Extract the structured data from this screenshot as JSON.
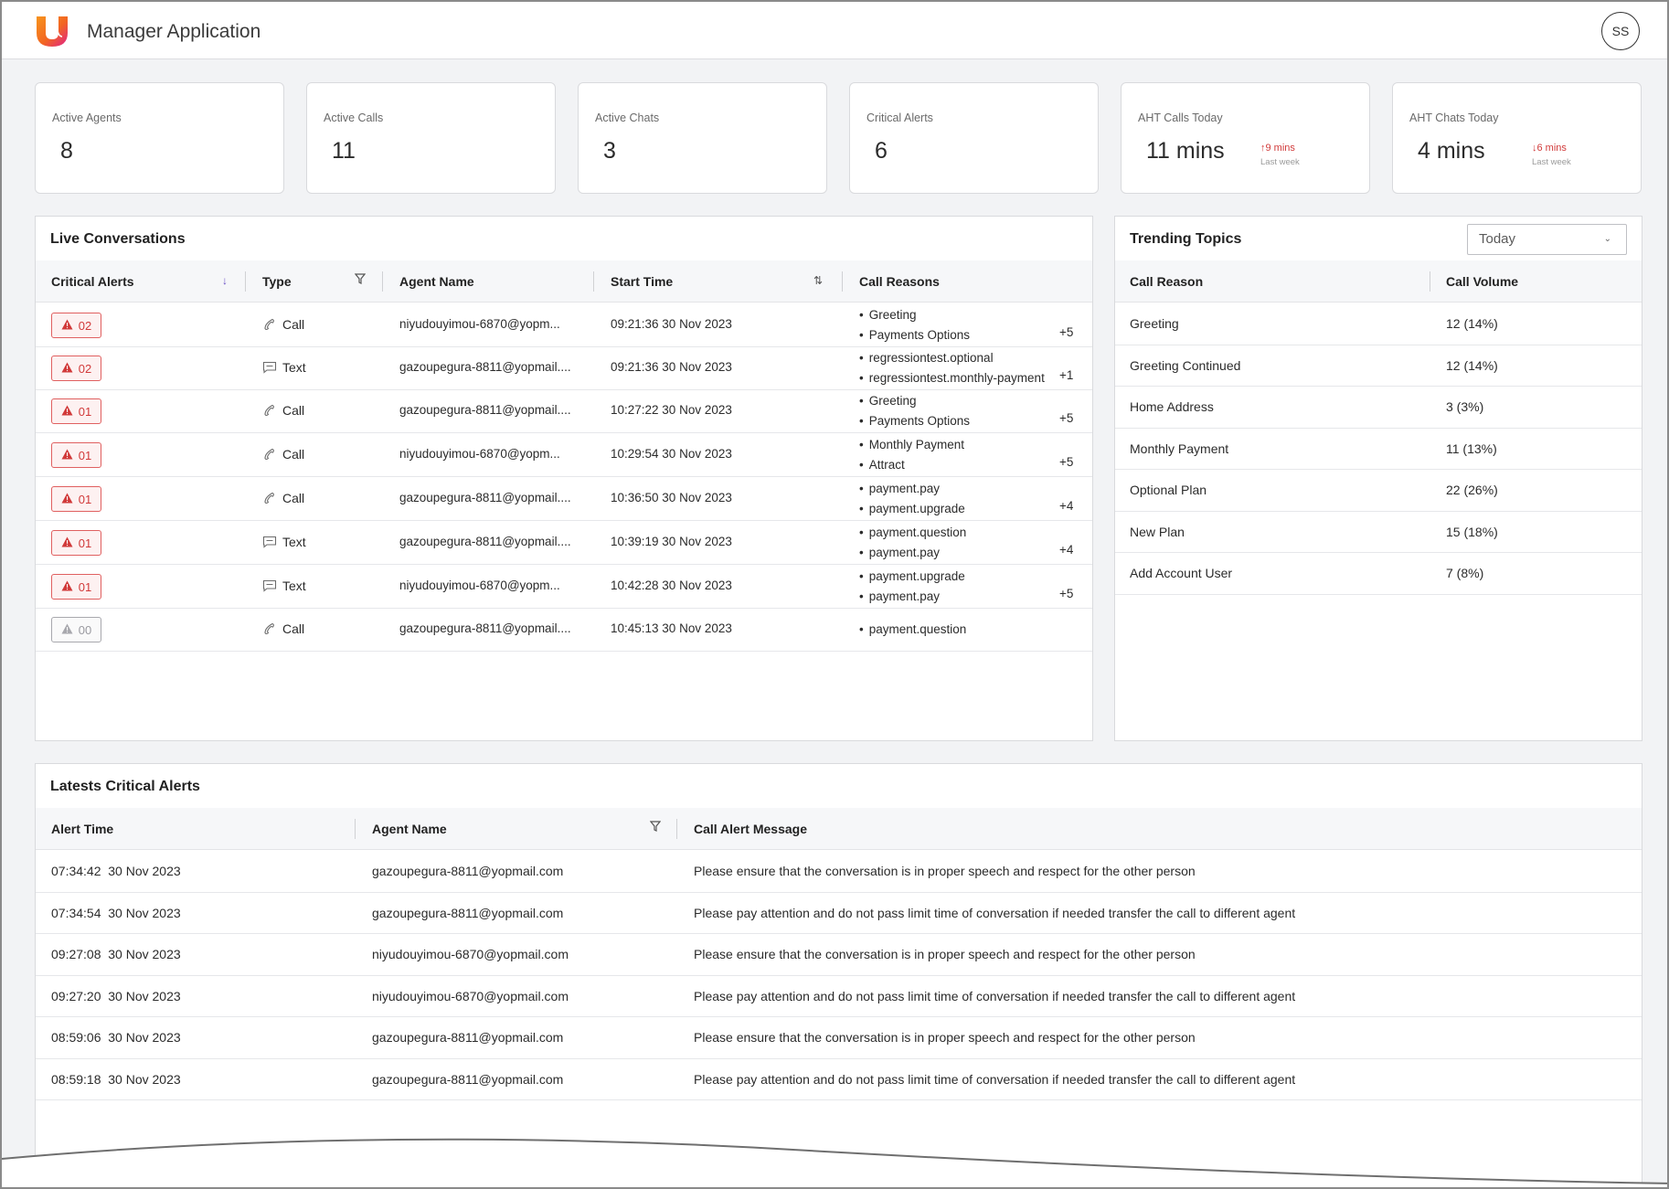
{
  "header": {
    "title": "Manager Application",
    "avatar_initials": "SS",
    "logo_icon": "u-logo-icon"
  },
  "stats": [
    {
      "label": "Active Agents",
      "value": "8"
    },
    {
      "label": "Active Calls",
      "value": "11"
    },
    {
      "label": "Active Chats",
      "value": "3"
    },
    {
      "label": "Critical Alerts",
      "value": "6"
    },
    {
      "label": "AHT Calls Today",
      "value": "11 mins",
      "trend": "9 mins",
      "trend_sub": "Last week",
      "trend_direction": "up"
    },
    {
      "label": "AHT Chats Today",
      "value": "4 mins",
      "trend": "6 mins",
      "trend_sub": "Last week",
      "trend_direction": "down"
    }
  ],
  "live": {
    "title": "Live Conversations",
    "columns": [
      "Critical Alerts",
      "Type",
      "Agent Name",
      "Start Time",
      "Call Reasons"
    ],
    "rows": [
      {
        "alert": "02",
        "type": "Call",
        "agent": "niyudouyimou-6870@yopm...",
        "start": "09:21:36 30 Nov 2023",
        "reasons": [
          "Greeting",
          "Payments Options"
        ],
        "more": "+5"
      },
      {
        "alert": "02",
        "type": "Text",
        "agent": "gazoupegura-8811@yopmail....",
        "start": "09:21:36 30 Nov 2023",
        "reasons": [
          "regressiontest.optional",
          "regressiontest.monthly-payment"
        ],
        "more": "+1"
      },
      {
        "alert": "01",
        "type": "Call",
        "agent": "gazoupegura-8811@yopmail....",
        "start": "10:27:22 30 Nov 2023",
        "reasons": [
          "Greeting",
          "Payments Options"
        ],
        "more": "+5"
      },
      {
        "alert": "01",
        "type": "Call",
        "agent": "niyudouyimou-6870@yopm...",
        "start": "10:29:54 30 Nov 2023",
        "reasons": [
          "Monthly Payment",
          "Attract"
        ],
        "more": "+5"
      },
      {
        "alert": "01",
        "type": "Call",
        "agent": "gazoupegura-8811@yopmail....",
        "start": "10:36:50 30 Nov 2023",
        "reasons": [
          "payment.pay",
          "payment.upgrade"
        ],
        "more": "+4"
      },
      {
        "alert": "01",
        "type": "Text",
        "agent": "gazoupegura-8811@yopmail....",
        "start": "10:39:19 30 Nov 2023",
        "reasons": [
          "payment.question",
          "payment.pay"
        ],
        "more": "+4"
      },
      {
        "alert": "01",
        "type": "Text",
        "agent": "niyudouyimou-6870@yopm...",
        "start": "10:42:28 30 Nov 2023",
        "reasons": [
          "payment.upgrade",
          "payment.pay"
        ],
        "more": "+5"
      },
      {
        "alert": "00",
        "type": "Call",
        "agent": "gazoupegura-8811@yopmail....",
        "start": "10:45:13 30 Nov 2023",
        "reasons": [
          "payment.question"
        ],
        "more": ""
      }
    ]
  },
  "trending": {
    "title": "Trending Topics",
    "period": "Today",
    "columns": [
      "Call Reason",
      "Call Volume"
    ],
    "rows": [
      {
        "reason": "Greeting",
        "volume": "12 (14%)"
      },
      {
        "reason": "Greeting Continued",
        "volume": "12 (14%)"
      },
      {
        "reason": "Home Address",
        "volume": "3 (3%)"
      },
      {
        "reason": "Monthly Payment",
        "volume": "11 (13%)"
      },
      {
        "reason": "Optional Plan",
        "volume": "22 (26%)"
      },
      {
        "reason": "New Plan",
        "volume": "15 (18%)"
      },
      {
        "reason": "Add Account User",
        "volume": "7 (8%)"
      }
    ]
  },
  "alerts": {
    "title": "Latests Critical Alerts",
    "columns": [
      "Alert Time",
      "Agent Name",
      "Call Alert Message"
    ],
    "rows": [
      {
        "time": "07:34:42  30 Nov 2023",
        "agent": "gazoupegura-8811@yopmail.com",
        "message": "Please ensure that the conversation is in proper speech and respect for the other person"
      },
      {
        "time": "07:34:54  30 Nov 2023",
        "agent": "gazoupegura-8811@yopmail.com",
        "message": "Please pay attention and do not pass limit time of conversation if needed transfer the call to different agent"
      },
      {
        "time": "09:27:08  30 Nov 2023",
        "agent": "niyudouyimou-6870@yopmail.com",
        "message": "Please ensure that the conversation is in proper speech and respect for the other person"
      },
      {
        "time": "09:27:20  30 Nov 2023",
        "agent": "niyudouyimou-6870@yopmail.com",
        "message": "Please pay attention and do not pass limit time of conversation if needed transfer the call to different agent"
      },
      {
        "time": "08:59:06  30 Nov 2023",
        "agent": "gazoupegura-8811@yopmail.com",
        "message": "Please ensure that the conversation is in proper speech and respect for the other person"
      },
      {
        "time": "08:59:18  30 Nov 2023",
        "agent": "gazoupegura-8811@yopmail.com",
        "message": "Please pay attention and do not pass limit time of conversation if needed transfer the call to different agent"
      }
    ]
  },
  "colors": {
    "alert_red": "#d13a3a",
    "accent_purple": "#6a4fc4",
    "logo_orange": "#f26522",
    "logo_pink": "#e0218a"
  }
}
